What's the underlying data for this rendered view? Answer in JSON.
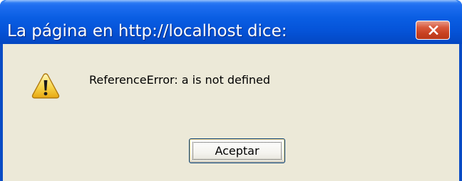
{
  "window": {
    "title": "La página en http://localhost dice:",
    "close_icon": "close-x-icon",
    "colors": {
      "titlebar": "#0553d8",
      "client_background": "#ece9d8",
      "close_button": "#d8583b"
    }
  },
  "dialog": {
    "icon": "warning-icon",
    "message": "ReferenceError: a is not defined",
    "ok_label": "Aceptar"
  }
}
